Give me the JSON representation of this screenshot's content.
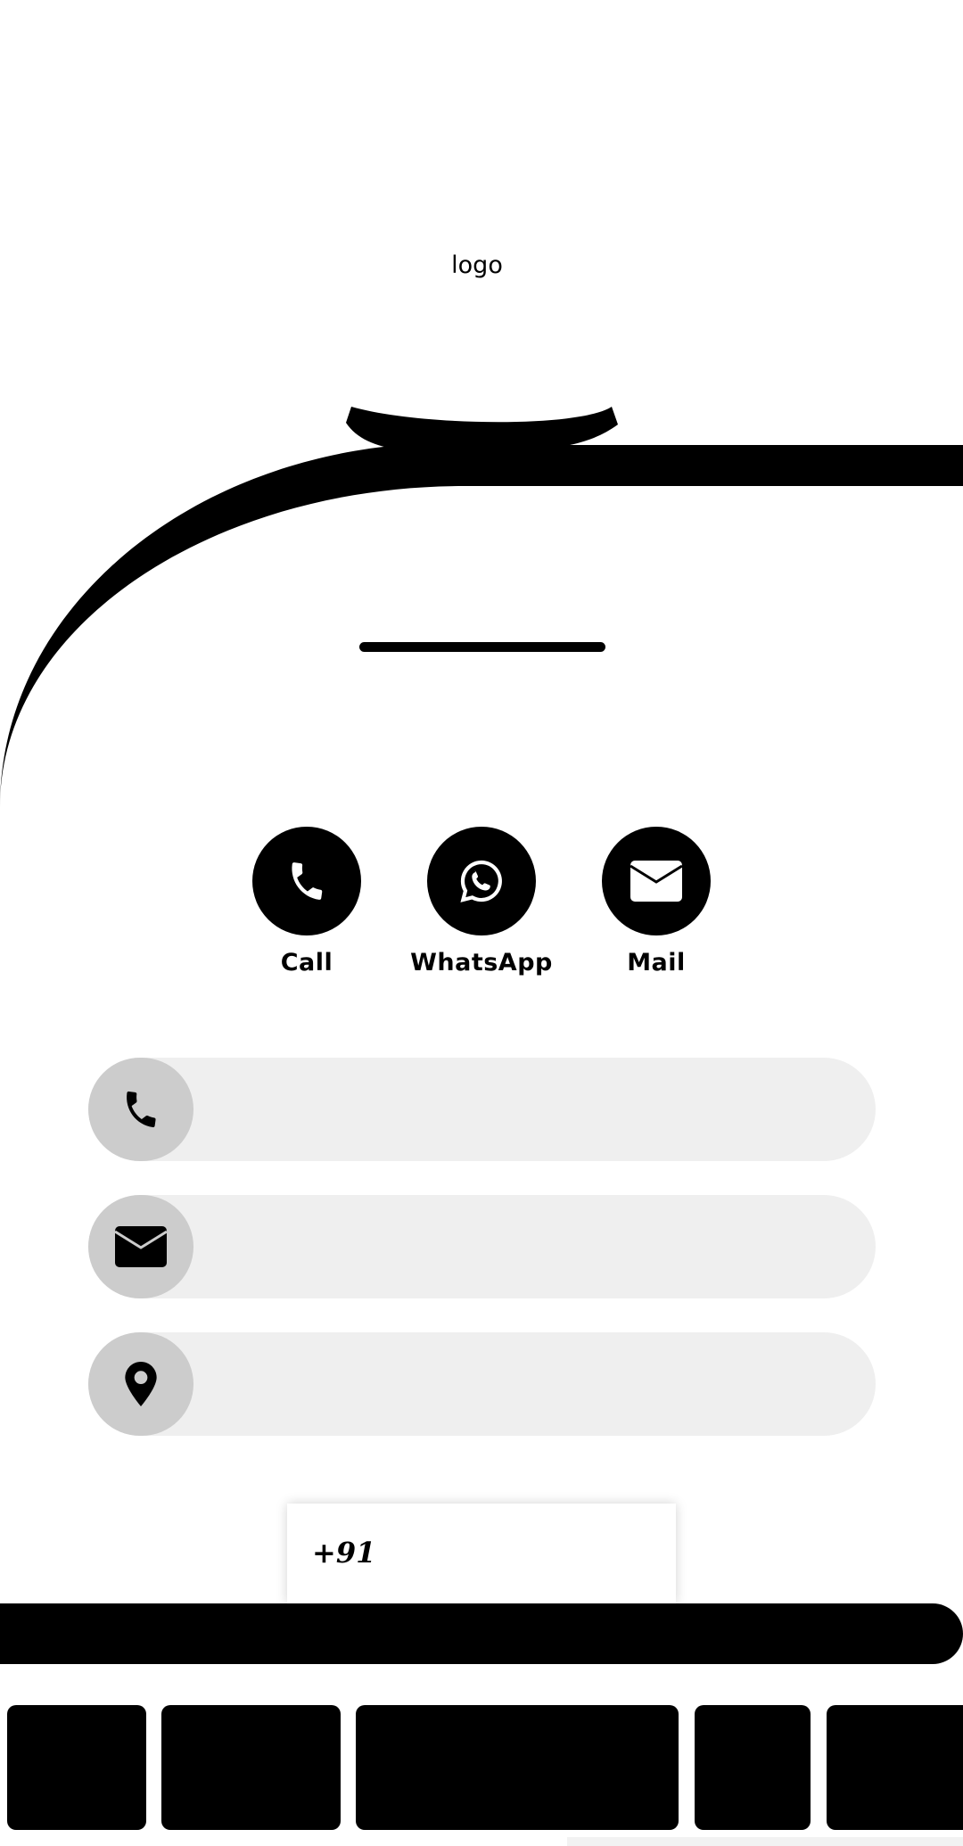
{
  "header": {
    "logo_text": "logo"
  },
  "actions": [
    {
      "label": "Call",
      "icon": "phone-icon"
    },
    {
      "label": "WhatsApp",
      "icon": "whatsapp-icon"
    },
    {
      "label": "Mail",
      "icon": "mail-icon"
    }
  ],
  "info_rows": [
    {
      "icon": "phone-icon",
      "value": ""
    },
    {
      "icon": "mail-icon",
      "value": ""
    },
    {
      "icon": "location-pin-icon",
      "value": ""
    }
  ],
  "share_form": {
    "country_code": "+91",
    "phone_value": ""
  },
  "colors": {
    "primary": "#000000",
    "row_bg": "#efefef",
    "icon_bubble": "#cccccc",
    "page_bg": "#ffffff"
  }
}
